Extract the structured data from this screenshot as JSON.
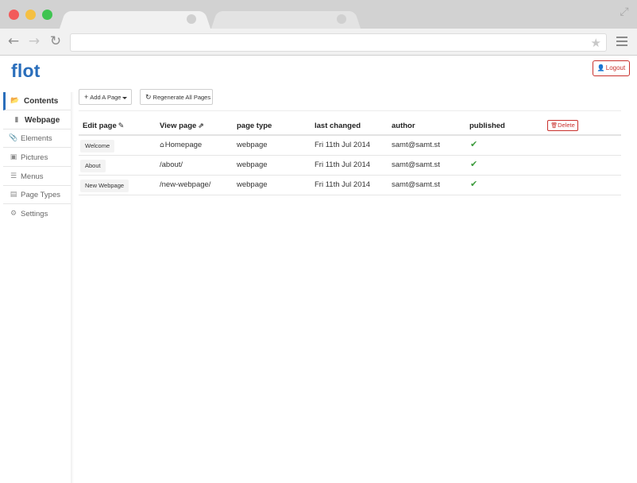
{
  "browser": {
    "address_value": "",
    "icons": {
      "back": "arrow-left-icon",
      "forward": "arrow-right-icon",
      "reload": "reload-icon",
      "bookmark": "star-icon",
      "menu": "hamburger-icon",
      "resize": "resize-icon"
    }
  },
  "app": {
    "logo": "flot",
    "logout_label": "Logout"
  },
  "sidebar": {
    "items": [
      {
        "label": "Contents",
        "icon": "folder-open-icon"
      },
      {
        "label": "Webpage",
        "icon": "file-icon"
      },
      {
        "label": "Elements",
        "icon": "paperclip-icon"
      },
      {
        "label": "Pictures",
        "icon": "picture-icon"
      },
      {
        "label": "Menus",
        "icon": "list-icon"
      },
      {
        "label": "Page Types",
        "icon": "document-icon"
      },
      {
        "label": "Settings",
        "icon": "gear-icon"
      }
    ]
  },
  "actions": {
    "add_label": "Add A Page",
    "regenerate_label": "Regenerate All Pages"
  },
  "table": {
    "headers": {
      "edit": "Edit page",
      "view": "View page",
      "type": "page type",
      "changed": "last changed",
      "author": "author",
      "published": "published"
    },
    "delete_label": "Delete",
    "rows": [
      {
        "edit": "Welcome",
        "view": "Homepage",
        "type": "webpage",
        "changed": "Fri 11th Jul 2014",
        "author": "samt@samt.st",
        "published": true
      },
      {
        "edit": "About",
        "view": "/about/",
        "type": "webpage",
        "changed": "Fri 11th Jul 2014",
        "author": "samt@samt.st",
        "published": true
      },
      {
        "edit": "New Webpage",
        "view": "/new-webpage/",
        "type": "webpage",
        "changed": "Fri 11th Jul 2014",
        "author": "samt@samt.st",
        "published": true
      }
    ]
  },
  "colors": {
    "brand": "#2a6ebb",
    "danger": "#c9302c",
    "success": "#3c9b3c"
  }
}
